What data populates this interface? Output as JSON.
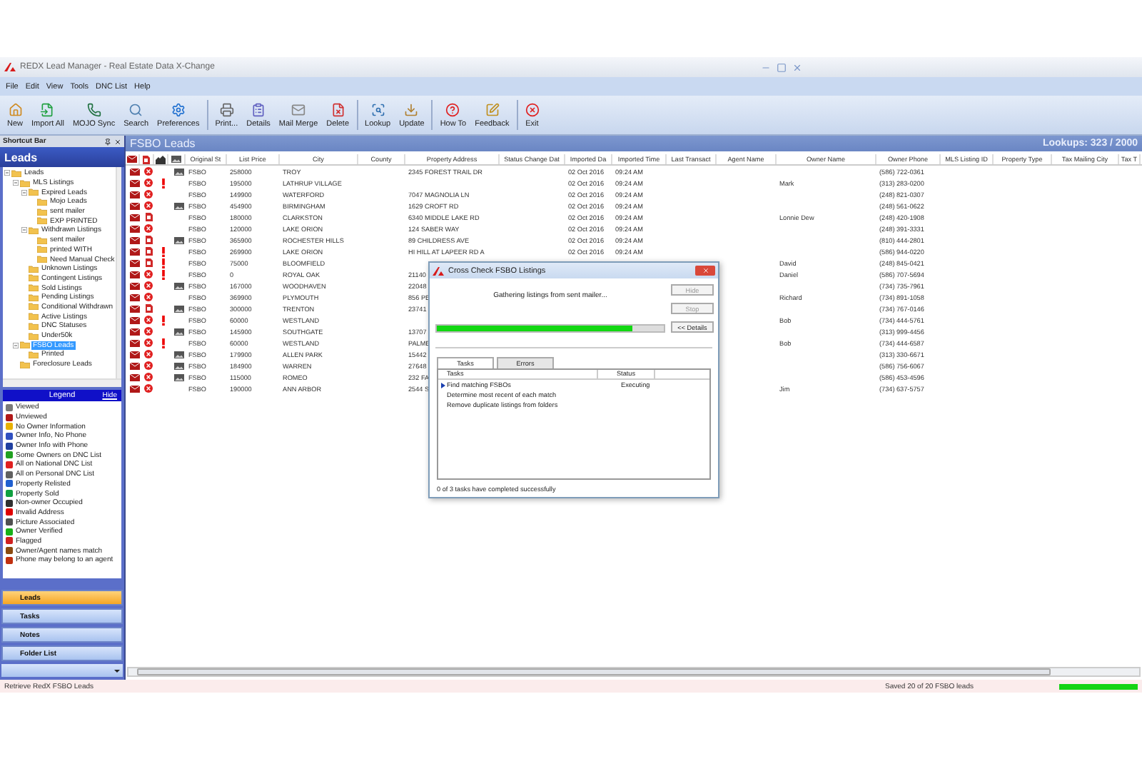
{
  "window": {
    "title": "REDX Lead Manager - Real Estate Data X-Change"
  },
  "menu": [
    "File",
    "Edit",
    "View",
    "Tools",
    "DNC List",
    "Help"
  ],
  "toolbar": [
    "New",
    "Import All",
    "MOJO Sync",
    "Search",
    "Preferences",
    "Print...",
    "Details",
    "Mail Merge",
    "Delete",
    "Lookup",
    "Update",
    "How To",
    "Feedback",
    "Exit"
  ],
  "sidebar": {
    "title": "Shortcut Bar",
    "section": "Leads",
    "tree": [
      {
        "label": "Leads",
        "selected": false,
        "children": [
          {
            "label": "MLS Listings",
            "selected": false,
            "children": [
              {
                "label": "Expired Leads",
                "selected": false,
                "children": [
                  {
                    "label": "Mojo Leads",
                    "selected": false
                  },
                  {
                    "label": "sent mailer",
                    "selected": false
                  },
                  {
                    "label": "EXP PRINTED",
                    "selected": false
                  }
                ]
              },
              {
                "label": "Withdrawn Listings",
                "selected": false,
                "children": [
                  {
                    "label": "sent mailer",
                    "selected": false
                  },
                  {
                    "label": "printed WITH",
                    "selected": false
                  },
                  {
                    "label": "Need Manual Check",
                    "selected": false
                  }
                ]
              },
              {
                "label": "Unknown Listings",
                "selected": false
              },
              {
                "label": "Contingent Listings",
                "selected": false
              },
              {
                "label": "Sold Listings",
                "selected": false
              },
              {
                "label": "Pending Listings",
                "selected": false
              },
              {
                "label": "Conditional Withdrawn",
                "selected": false
              },
              {
                "label": "Active Listings",
                "selected": false
              },
              {
                "label": "DNC Statuses",
                "selected": false
              },
              {
                "label": "Under50k",
                "selected": false
              }
            ]
          },
          {
            "label": "FSBO Leads",
            "selected": true,
            "children": [
              {
                "label": "Printed",
                "selected": false
              }
            ]
          },
          {
            "label": "Foreclosure Leads",
            "selected": false
          }
        ]
      }
    ],
    "legend": {
      "title": "Legend",
      "hide_link": "Hide",
      "items": [
        {
          "label": "Viewed",
          "color": "#7a7a7a"
        },
        {
          "label": "Unviewed",
          "color": "#b01818"
        },
        {
          "label": "No Owner Information",
          "color": "#e8b000"
        },
        {
          "label": "Owner Info, No Phone",
          "color": "#3050c0"
        },
        {
          "label": "Owner Info with Phone",
          "color": "#2040a0"
        },
        {
          "label": "Some Owners on DNC List",
          "color": "#20a020"
        },
        {
          "label": "All on National DNC List",
          "color": "#e02020"
        },
        {
          "label": "All on Personal DNC List",
          "color": "#606060"
        },
        {
          "label": "Property Relisted",
          "color": "#2060d0"
        },
        {
          "label": "Property Sold",
          "color": "#10a040"
        },
        {
          "label": "Non-owner Occupied",
          "color": "#303030"
        },
        {
          "label": "Invalid Address",
          "color": "#e00000"
        },
        {
          "label": "Picture Associated",
          "color": "#505050"
        },
        {
          "label": "Owner Verified",
          "color": "#18b018"
        },
        {
          "label": "Flagged",
          "color": "#d02020"
        },
        {
          "label": "Owner/Agent names match",
          "color": "#8a4a10"
        },
        {
          "label": "Phone may belong to an agent",
          "color": "#c03010"
        }
      ]
    },
    "nav": [
      {
        "label": "Leads",
        "selected": true
      },
      {
        "label": "Tasks",
        "selected": false
      },
      {
        "label": "Notes",
        "selected": false
      },
      {
        "label": "Folder List",
        "selected": false
      }
    ]
  },
  "panel": {
    "title": "FSBO Leads",
    "lookups": "Lookups: 323 / 2000"
  },
  "table": {
    "columns": [
      "Original St",
      "List Price",
      "City",
      "County",
      "Property Address",
      "Status Change Dat",
      "Imported Da",
      "Imported Time",
      "Last Transact",
      "Agent Name",
      "Owner Name",
      "Owner Phone",
      "MLS Listing ID",
      "Property Type",
      "Tax Mailing City",
      "Tax T"
    ],
    "rows": [
      {
        "viewed": false,
        "kind": "dnc",
        "invalid_address": false,
        "picture": true,
        "original": "FSBO",
        "price": "258000",
        "city": "TROY",
        "address": "2345 FOREST TRAIL DR",
        "imported_date": "02 Oct 2016",
        "imported_time": "09:24 AM",
        "phone": "(586) 722-0361"
      },
      {
        "viewed": false,
        "kind": "dnc",
        "invalid_address": true,
        "picture": false,
        "original": "FSBO",
        "price": "195000",
        "city": "LATHRUP VILLAGE",
        "imported_date": "02 Oct 2016",
        "imported_time": "09:24 AM",
        "owner": "Mark",
        "phone": "(313) 283-0200"
      },
      {
        "viewed": false,
        "kind": "dnc",
        "invalid_address": false,
        "picture": false,
        "original": "FSBO",
        "price": "149900",
        "city": "WATERFORD",
        "address": "7047 MAGNOLIA LN",
        "imported_date": "02 Oct 2016",
        "imported_time": "09:24 AM",
        "phone": "(248) 821-0307"
      },
      {
        "viewed": false,
        "kind": "dnc",
        "invalid_address": false,
        "picture": true,
        "original": "FSBO",
        "price": "454900",
        "city": "BIRMINGHAM",
        "address": "1629 CROFT RD",
        "imported_date": "02 Oct 2016",
        "imported_time": "09:24 AM",
        "phone": "(248) 561-0622"
      },
      {
        "viewed": false,
        "kind": "info",
        "invalid_address": false,
        "picture": false,
        "original": "FSBO",
        "price": "180000",
        "city": "CLARKSTON",
        "address": "6340 MIDDLE LAKE RD",
        "imported_date": "02 Oct 2016",
        "imported_time": "09:24 AM",
        "owner": "Lonnie Dew",
        "phone": "(248) 420-1908"
      },
      {
        "viewed": false,
        "kind": "dnc",
        "invalid_address": false,
        "picture": false,
        "original": "FSBO",
        "price": "120000",
        "city": "LAKE ORION",
        "address": "124 SABER WAY",
        "imported_date": "02 Oct 2016",
        "imported_time": "09:24 AM",
        "phone": "(248) 391-3331"
      },
      {
        "viewed": false,
        "kind": "info",
        "invalid_address": false,
        "picture": true,
        "original": "FSBO",
        "price": "365900",
        "city": "ROCHESTER HILLS",
        "address": "89 CHILDRESS AVE",
        "imported_date": "02 Oct 2016",
        "imported_time": "09:24 AM",
        "phone": "(810) 444-2801"
      },
      {
        "viewed": false,
        "kind": "info",
        "invalid_address": true,
        "picture": false,
        "original": "FSBO",
        "price": "269900",
        "city": "LAKE ORION",
        "address": "HI HILL AT LAPEER RD A",
        "imported_date": "02 Oct 2016",
        "imported_time": "09:24 AM",
        "phone": "(586) 944-0220"
      },
      {
        "viewed": false,
        "kind": "info",
        "invalid_address": true,
        "picture": false,
        "original": "FSBO",
        "price": "75000",
        "city": "BLOOMFIELD",
        "owner": "David",
        "phone": "(248) 845-0421"
      },
      {
        "viewed": false,
        "kind": "dnc",
        "invalid_address": true,
        "picture": false,
        "original": "FSBO",
        "price": "0",
        "city": "ROYAL OAK",
        "address": "21140",
        "owner": "Daniel",
        "phone": "(586) 707-5694"
      },
      {
        "viewed": false,
        "kind": "dnc",
        "invalid_address": false,
        "picture": true,
        "original": "FSBO",
        "price": "167000",
        "city": "WOODHAVEN",
        "address": "22048",
        "phone": "(734) 735-7961"
      },
      {
        "viewed": false,
        "kind": "dnc",
        "invalid_address": false,
        "picture": false,
        "original": "FSBO",
        "price": "369900",
        "city": "PLYMOUTH",
        "address": "856 PE",
        "owner": "Richard",
        "phone": "(734) 891-1058"
      },
      {
        "viewed": false,
        "kind": "info",
        "invalid_address": false,
        "picture": true,
        "original": "FSBO",
        "price": "300000",
        "city": "TRENTON",
        "address": "23741",
        "phone": "(734) 767-0146"
      },
      {
        "viewed": false,
        "kind": "dnc",
        "invalid_address": true,
        "picture": false,
        "original": "FSBO",
        "price": "60000",
        "city": "WESTLAND",
        "owner": "Bob",
        "phone": "(734) 444-5761"
      },
      {
        "viewed": false,
        "kind": "dnc",
        "invalid_address": false,
        "picture": true,
        "original": "FSBO",
        "price": "145900",
        "city": "SOUTHGATE",
        "address": "13707",
        "phone": "(313) 999-4456"
      },
      {
        "viewed": false,
        "kind": "dnc",
        "invalid_address": true,
        "picture": false,
        "original": "FSBO",
        "price": "60000",
        "city": "WESTLAND",
        "address": "PALME",
        "owner": "Bob",
        "phone": "(734) 444-6587"
      },
      {
        "viewed": false,
        "kind": "dnc",
        "invalid_address": false,
        "picture": true,
        "original": "FSBO",
        "price": "179900",
        "city": "ALLEN PARK",
        "address": "15442",
        "phone": "(313) 330-6671"
      },
      {
        "viewed": false,
        "kind": "dnc",
        "invalid_address": false,
        "picture": true,
        "original": "FSBO",
        "price": "184900",
        "city": "WARREN",
        "address": "27648",
        "phone": "(586) 756-6067"
      },
      {
        "viewed": false,
        "kind": "dnc",
        "invalid_address": false,
        "picture": true,
        "original": "FSBO",
        "price": "115000",
        "city": "ROMEO",
        "address": "232 FA",
        "phone": "(586) 453-4596"
      },
      {
        "viewed": false,
        "kind": "dnc",
        "invalid_address": false,
        "picture": false,
        "original": "FSBO",
        "price": "190000",
        "city": "ANN ARBOR",
        "address": "2544 S",
        "owner": "Jim",
        "phone": "(734) 637-5757"
      }
    ]
  },
  "dialog": {
    "title": "Cross Check FSBO Listings",
    "message": "Gathering listings from sent mailer...",
    "level": 0.86,
    "buttons": [
      {
        "label": "Hide",
        "disabled": true
      },
      {
        "label": "Stop",
        "disabled": true
      },
      {
        "label": "<< Details",
        "disabled": false
      }
    ],
    "tabs": [
      {
        "label": "Tasks",
        "selected": true
      },
      {
        "label": "Errors",
        "selected": false
      }
    ],
    "task_columns": [
      "Tasks",
      "Status"
    ],
    "tasks": [
      {
        "name": "Find matching FSBOs",
        "status": "Executing",
        "current": true
      },
      {
        "name": "Determine most recent of each match",
        "current": false
      },
      {
        "name": "Remove duplicate listings from folders",
        "current": false
      }
    ],
    "summary": "0 of 3 tasks have completed successfully"
  },
  "status_bar": {
    "left": "Retrieve RedX FSBO Leads",
    "right": "Saved 20 of 20 FSBO leads",
    "level": 1
  }
}
